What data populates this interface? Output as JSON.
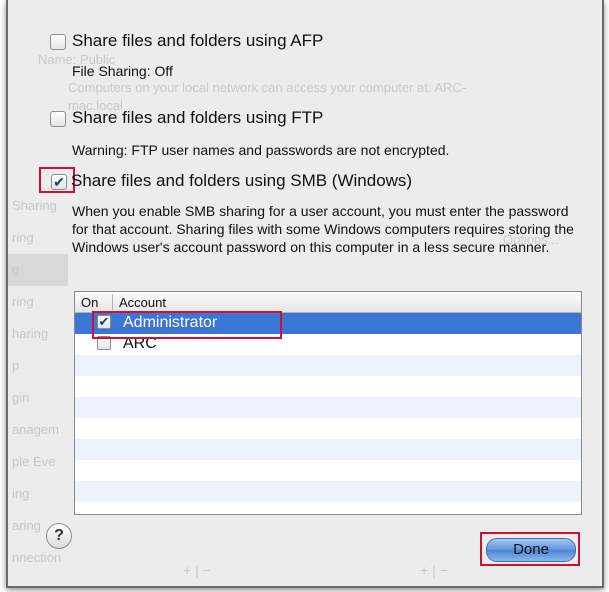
{
  "background": {
    "header_ghost_1": "Name:   Public",
    "header_ghost_2": "Computers on your local network can access your computer at: ARC-",
    "header_ghost_3": "mac.local",
    "ghost_btn": "Options...",
    "sidebar_ghost": [
      "Sharing",
      "ring",
      "g",
      "ring",
      "haring",
      "p",
      "gin",
      "anagem",
      "ple Eve",
      "ing",
      "aring",
      "nnection"
    ],
    "ghost_pm": "+ | −"
  },
  "options": {
    "afp": {
      "label": "Share files and folders using AFP",
      "checked": false,
      "status": "File Sharing: Off"
    },
    "ftp": {
      "label": "Share files and folders using FTP",
      "checked": false,
      "warning": "Warning: FTP user names and passwords are not encrypted."
    },
    "smb": {
      "label": "Share files and folders using SMB (Windows)",
      "checked": true,
      "description": "When you enable SMB sharing for a user account, you must enter the password for that account. Sharing files with some Windows computers requires storing the Windows user's account password on this computer in a less secure manner."
    }
  },
  "accounts_table": {
    "columns": [
      "On",
      "Account"
    ],
    "rows": [
      {
        "on": true,
        "account": "Administrator",
        "selected": true
      },
      {
        "on": false,
        "account": "ARC",
        "selected": false
      }
    ]
  },
  "footer": {
    "help_label": "?",
    "done_label": "Done"
  },
  "colors": {
    "highlight": "#d0102c",
    "selection": "#3b76d6",
    "sheet": "#ececec"
  },
  "checkmark": "✔"
}
